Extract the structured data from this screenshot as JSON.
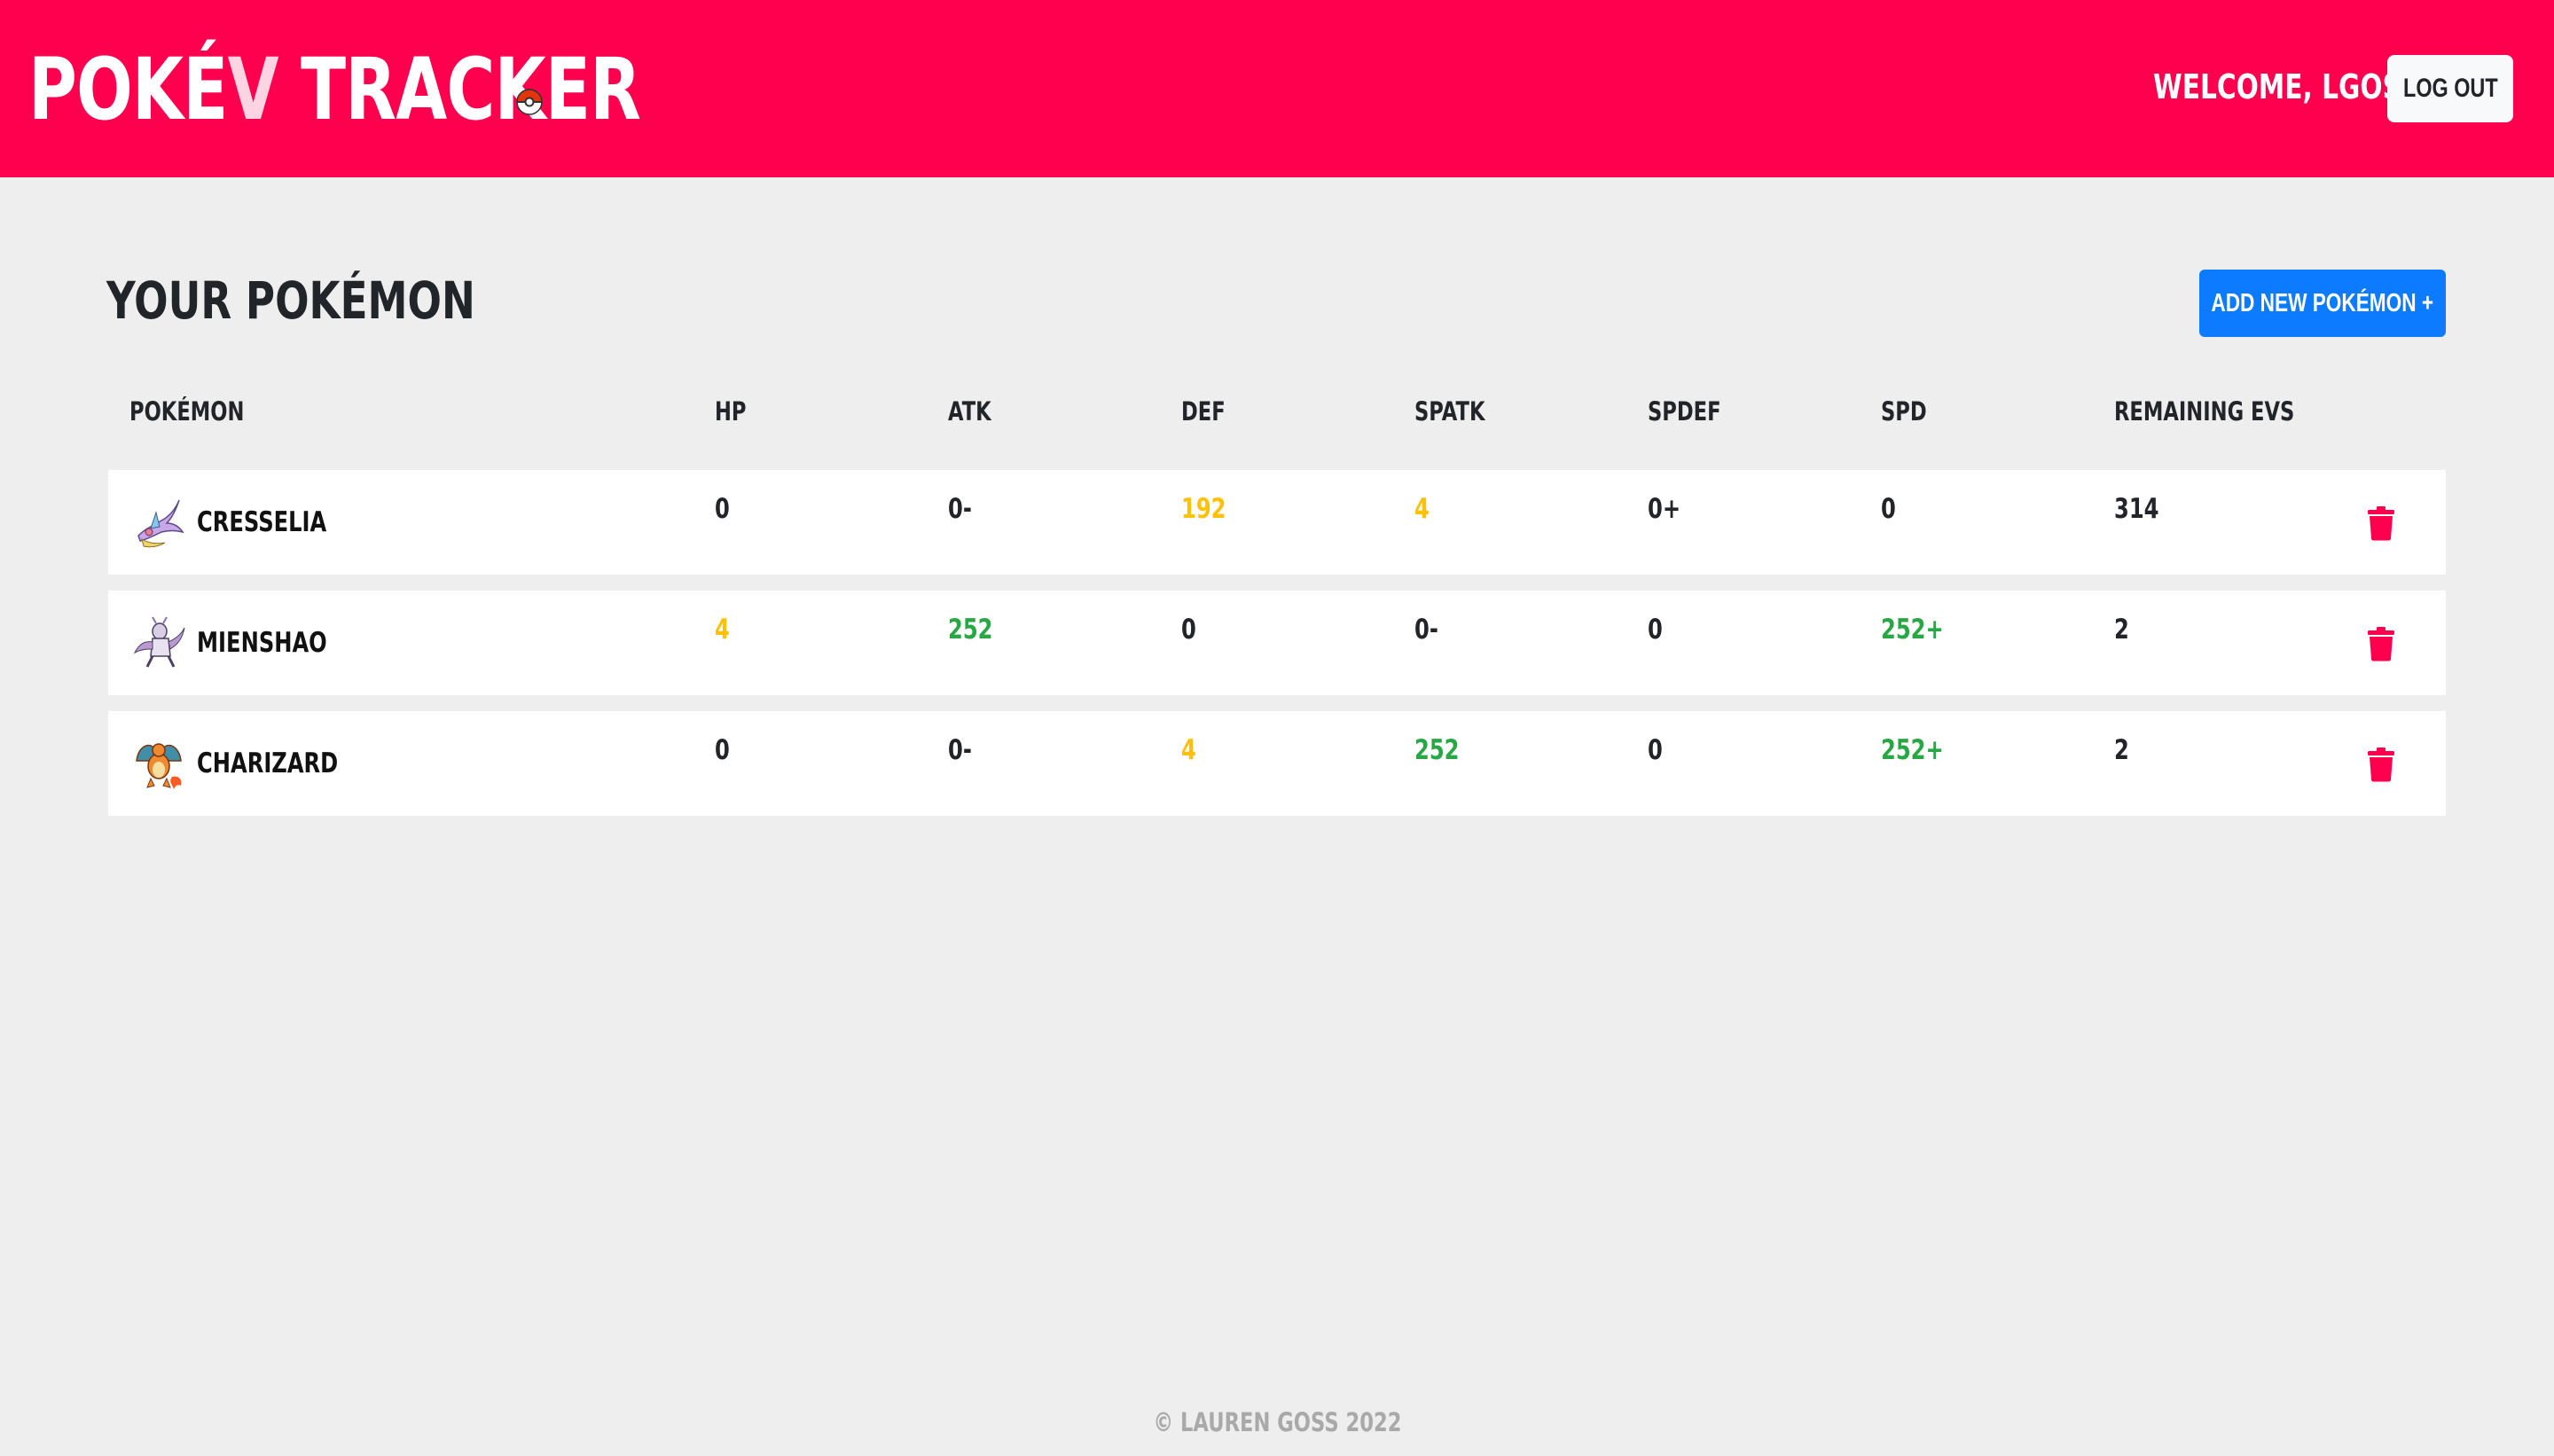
{
  "header": {
    "brand_main": "POKÉ",
    "brand_accent": "V",
    "brand_rest": " TRACKER",
    "welcome": "WELCOME, LGOSS",
    "logout_label": "LOG OUT",
    "brand_color": "#ff004f"
  },
  "main": {
    "title": "YOUR POKÉMON",
    "add_button_label": "ADD NEW POKÉMON +",
    "add_button_color": "#0d7bff"
  },
  "table": {
    "columns": [
      "POKÉMON",
      "HP",
      "ATK",
      "DEF",
      "SPATK",
      "SPDEF",
      "SPD",
      "REMAINING EVS"
    ],
    "rows": [
      {
        "name": "CRESSELIA",
        "sprite_icon": "cresselia-sprite-icon",
        "hp": {
          "value": "0",
          "status": "normal"
        },
        "atk": {
          "value": "0-",
          "status": "normal"
        },
        "def": {
          "value": "192",
          "status": "yellow"
        },
        "spatk": {
          "value": "4",
          "status": "yellow"
        },
        "spdef": {
          "value": "0+",
          "status": "normal"
        },
        "spd": {
          "value": "0",
          "status": "normal"
        },
        "remaining": "314"
      },
      {
        "name": "MIENSHAO",
        "sprite_icon": "mienshao-sprite-icon",
        "hp": {
          "value": "4",
          "status": "yellow"
        },
        "atk": {
          "value": "252",
          "status": "green"
        },
        "def": {
          "value": "0",
          "status": "normal"
        },
        "spatk": {
          "value": "0-",
          "status": "normal"
        },
        "spdef": {
          "value": "0",
          "status": "normal"
        },
        "spd": {
          "value": "252+",
          "status": "green"
        },
        "remaining": "2"
      },
      {
        "name": "CHARIZARD",
        "sprite_icon": "charizard-sprite-icon",
        "hp": {
          "value": "0",
          "status": "normal"
        },
        "atk": {
          "value": "0-",
          "status": "normal"
        },
        "def": {
          "value": "4",
          "status": "yellow"
        },
        "spatk": {
          "value": "252",
          "status": "green"
        },
        "spdef": {
          "value": "0",
          "status": "normal"
        },
        "spd": {
          "value": "252+",
          "status": "green"
        },
        "remaining": "2"
      }
    ],
    "status_colors": {
      "normal": "#212529",
      "yellow": "#ffc107",
      "green": "#28a745"
    },
    "delete_icon": "trash-icon",
    "delete_color": "#ff004f"
  },
  "footer": {
    "text": "© LAUREN GOSS 2022"
  }
}
